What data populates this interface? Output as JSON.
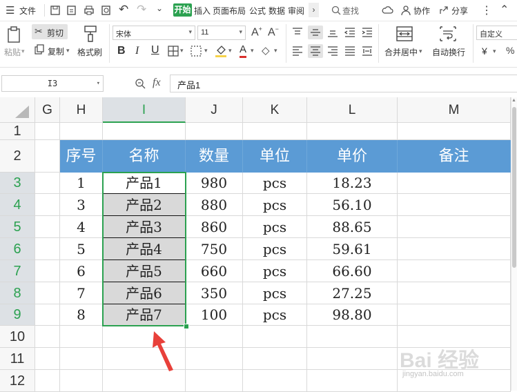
{
  "menubar": {
    "menu_label": "文件",
    "tabs": [
      "开始",
      "插入",
      "页面布局",
      "公式",
      "数据",
      "审阅"
    ],
    "search_label": "查找",
    "collab_label": "协作",
    "share_label": "分享"
  },
  "ribbon": {
    "paste": "粘贴",
    "cut": "剪切",
    "copy": "复制",
    "format_painter": "格式刷",
    "font_name": "宋体",
    "font_size": "11",
    "bold": "B",
    "italic": "I",
    "underline": "U",
    "merge_center": "合并居中",
    "wrap_text": "自动换行",
    "number_format": "自定义",
    "currency": "¥"
  },
  "formula_bar": {
    "cell_ref": "I3",
    "fx": "fx",
    "content": "产品1"
  },
  "sheet": {
    "columns": [
      "G",
      "H",
      "I",
      "J",
      "K",
      "L",
      "M"
    ],
    "rows": [
      "1",
      "2",
      "3",
      "4",
      "5",
      "6",
      "7",
      "8",
      "9",
      "10",
      "11",
      "12"
    ],
    "headers": [
      "序号",
      "名称",
      "数量",
      "单位",
      "单价",
      "备注"
    ],
    "data": [
      [
        "1",
        "产品1",
        "980",
        "pcs",
        "18.23",
        ""
      ],
      [
        "3",
        "产品2",
        "880",
        "pcs",
        "56.10",
        ""
      ],
      [
        "4",
        "产品3",
        "860",
        "pcs",
        "88.65",
        ""
      ],
      [
        "5",
        "产品4",
        "750",
        "pcs",
        "59.61",
        ""
      ],
      [
        "6",
        "产品5",
        "660",
        "pcs",
        "66.60",
        ""
      ],
      [
        "7",
        "产品6",
        "350",
        "pcs",
        "27.25",
        ""
      ],
      [
        "8",
        "产品7",
        "100",
        "pcs",
        "98.80",
        ""
      ]
    ],
    "active_column": "I",
    "header_color": "#5b9bd5",
    "selection_color": "#2ba150"
  },
  "watermark": {
    "brand": "Bai 经验",
    "url": "jingyan.baidu.com"
  }
}
